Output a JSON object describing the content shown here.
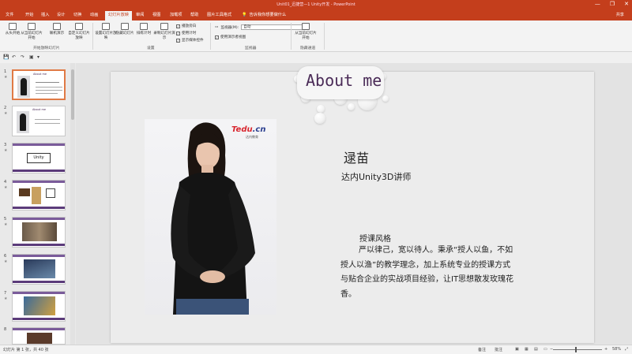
{
  "window": {
    "title": "Unit01_迅捷营—1 Unity开发 - PowerPoint",
    "controls": [
      "—",
      "❐",
      "✕"
    ]
  },
  "tabs": [
    "文件",
    "开始",
    "插入",
    "设计",
    "切换",
    "动画",
    "幻灯片放映",
    "审阅",
    "视图",
    "加载项",
    "帮助",
    "图片工具格式"
  ],
  "active_tab": "幻灯片放映",
  "tell_me": "告诉我你想要做什么",
  "share": "共享",
  "ribbon": {
    "buttons": [
      "从头开始",
      "从当前幻灯片开始",
      "联机演示",
      "自定义幻灯片放映",
      "设置幻灯片放映",
      "隐藏幻灯片",
      "排练计时",
      "录制幻灯片演示",
      "从当前幻灯片开始"
    ],
    "checkboxes": [
      {
        "label": "播放旁白",
        "checked": true
      },
      {
        "label": "使用计时",
        "checked": true
      },
      {
        "label": "显示媒体控件",
        "checked": true
      }
    ],
    "monitor": {
      "label": "监视器(M):",
      "value": "自动"
    },
    "presenter_view": {
      "label": "使用演示者视图",
      "checked": true
    },
    "groups": [
      "开始放映幻灯片",
      "设置",
      "监视器",
      "隐藏通道"
    ]
  },
  "quick_access": [
    "💾",
    "↶",
    "↷",
    "▣",
    "▾"
  ],
  "thumbnails": [
    {
      "num": "1",
      "caption": "About me",
      "selected": true
    },
    {
      "num": "2",
      "caption": "About me",
      "selected": false
    },
    {
      "num": "3",
      "caption": "Unity",
      "selected": false
    },
    {
      "num": "4",
      "caption": "",
      "selected": false
    },
    {
      "num": "5",
      "caption": "",
      "selected": false
    },
    {
      "num": "6",
      "caption": "",
      "selected": false
    },
    {
      "num": "7",
      "caption": "",
      "selected": false
    },
    {
      "num": "8",
      "caption": "",
      "selected": false
    }
  ],
  "slide": {
    "title": "About me",
    "logo_main": "Tedu",
    "logo_suffix": ".cn",
    "logo_sub": "达内教育",
    "name": "逯苗",
    "role": "达内Unity3D讲师",
    "style_heading": "授课风格",
    "style_text": "严以律己，宽以待人。秉承“授人以鱼，不如授人以渔”的教学理念，加上系统专业的授课方式与贴合企业的实战项目经验，让IT思想散发玫瑰花香。"
  },
  "status": {
    "slide_info": "幻灯片 第 1 张，共 40 张",
    "notes": "备注",
    "comments": "批注",
    "zoom": "58%"
  },
  "colors": {
    "accent": "#c43e1c",
    "title_purple": "#4a2b57"
  }
}
